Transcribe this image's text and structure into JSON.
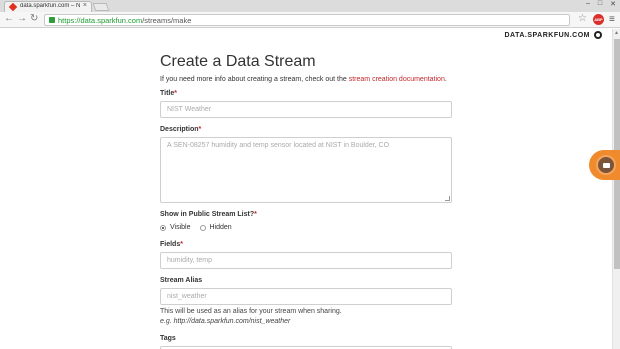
{
  "browser": {
    "tab_title": "data.sparkfun.com – New",
    "tab_close": "×",
    "win_minimize": "–",
    "win_maximize": "□",
    "win_close": "✕",
    "url_scheme_host": "https://data.sparkfun.com",
    "url_path": "/streams/make",
    "back_icon": "arrow-left-icon",
    "forward_icon": "arrow-right-icon",
    "reload_icon": "reload-icon",
    "star_icon": "star-icon",
    "menu_icon": "hamburger-icon",
    "extension_badge": "ABP",
    "accent_url_color": "#1a9c31"
  },
  "header": {
    "brand": "DATA.SPARKFUN.COM"
  },
  "form": {
    "heading": "Create a Data Stream",
    "intro_text": "If you need more info about creating a stream, check out the ",
    "intro_link": "stream creation documentation",
    "intro_end": ".",
    "title": {
      "label": "Title",
      "required": "*",
      "placeholder": "NIST Weather"
    },
    "description": {
      "label": "Description",
      "required": "*",
      "placeholder": "A SEN-08257 humidity and temp sensor located at NIST in Boulder, CO"
    },
    "visibility": {
      "label": "Show in Public Stream List?",
      "required": "*",
      "options": [
        "Visible",
        "Hidden"
      ],
      "selected": "Visible"
    },
    "fields": {
      "label": "Fields",
      "required": "*",
      "placeholder": "humidity, temp"
    },
    "alias": {
      "label": "Stream Alias",
      "placeholder": "nist_weather",
      "help": "This will be used as an alias for your stream when sharing.",
      "example": "e.g. http://data.sparkfun.com/nist_weather"
    },
    "tags": {
      "label": "Tags"
    }
  },
  "colors": {
    "link": "#c0282d",
    "float_button": "#ef8b2c"
  }
}
